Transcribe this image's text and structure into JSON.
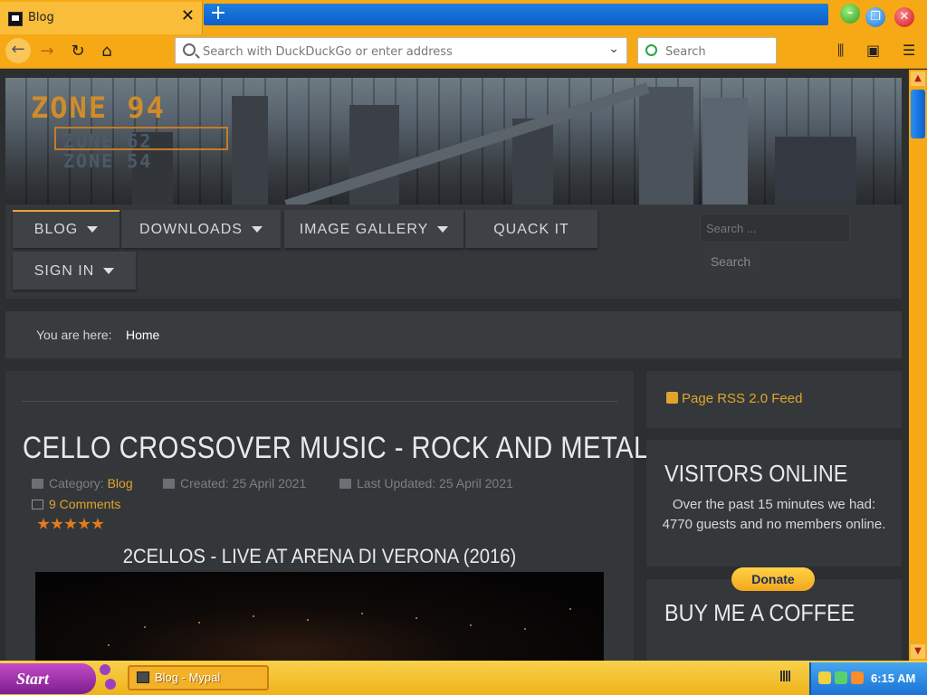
{
  "browser": {
    "tab": {
      "title": "Blog",
      "close": "✕"
    },
    "new_tab": "+",
    "window": {
      "minimize": "–",
      "maximize": "❐",
      "close": "✕"
    },
    "url_placeholder": "Search with DuckDuckGo or enter address",
    "search_placeholder": "Search",
    "icons": [
      "back-icon",
      "forward-icon",
      "reload-icon",
      "home-icon",
      "library-icon",
      "sidebar-icon",
      "menu-icon"
    ]
  },
  "site": {
    "logo": {
      "main": "ZONE 94",
      "sub1": "ZONE 62",
      "sub2": "ZONE 54"
    },
    "menu": [
      {
        "label": "BLOG",
        "dropdown": true,
        "active": true
      },
      {
        "label": "DOWNLOADS",
        "dropdown": true
      },
      {
        "label": "IMAGE GALLERY",
        "dropdown": true
      },
      {
        "label": "QUACK IT",
        "dropdown": false
      },
      {
        "label": "SIGN IN",
        "dropdown": true
      }
    ],
    "search": {
      "placeholder": "Search ...",
      "button": "Search"
    },
    "breadcrumb": {
      "label": "You are here:",
      "home": "Home"
    }
  },
  "article": {
    "title": "CELLO CROSSOVER MUSIC - ROCK AND METAL",
    "category_label": "Category:",
    "category": "Blog",
    "created": "Created: 25 April 2021",
    "updated": "Last Updated: 25 April 2021",
    "comments": "9 Comments",
    "rating": 5,
    "video_title": "2CELLOS - LIVE AT ARENA DI VERONA (2016)"
  },
  "sidebar": {
    "rss": "Page RSS 2.0 Feed",
    "visitors": {
      "title": "VISITORS ONLINE",
      "text": "Over the past 15 minutes we had: 4770 guests and no members online."
    },
    "coffee": {
      "title": "BUY ME A COFFEE",
      "donate": "Donate"
    }
  },
  "taskbar": {
    "start": "Start",
    "window_button": "Blog - Mypal",
    "clock": "6:15 AM"
  },
  "colors": {
    "accent": "#e0a42d",
    "chrome": "#f6a915",
    "page_bg": "#2c2e30",
    "tabbar_blue": "#0b5ec8"
  }
}
